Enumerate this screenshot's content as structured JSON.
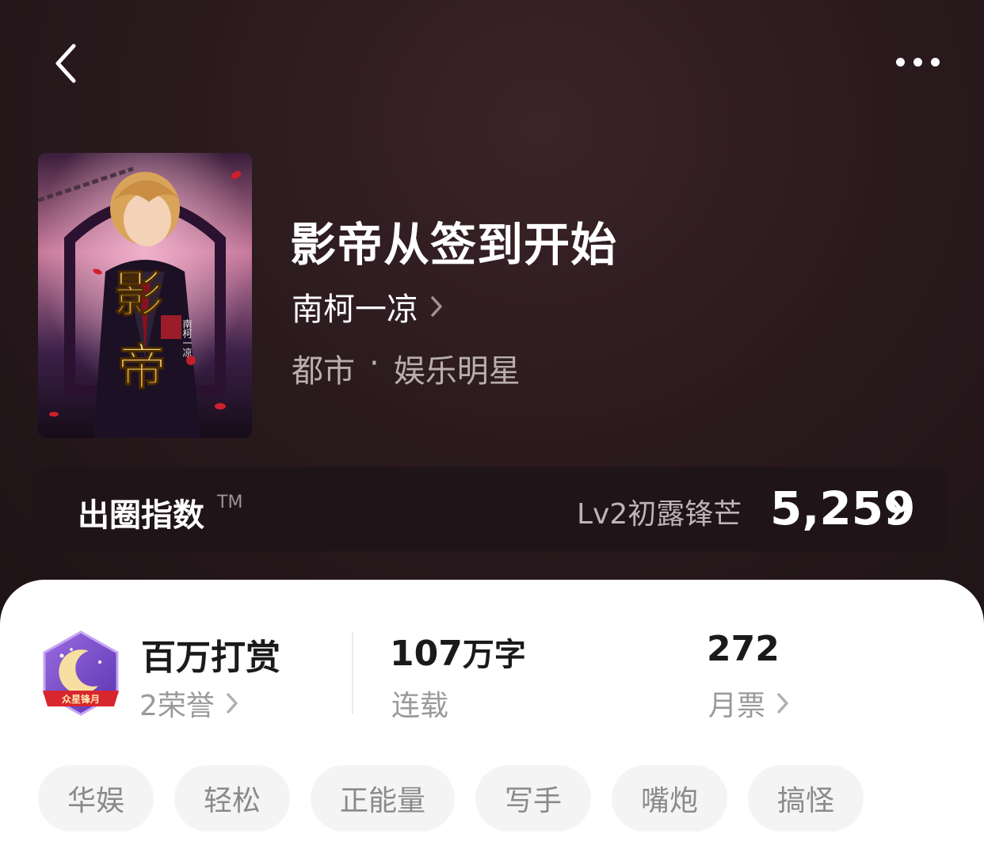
{
  "header": {
    "back_icon": "chevron-left-icon",
    "more_icon": "more-dots-icon"
  },
  "book": {
    "title": "影帝从签到开始",
    "author": "南柯一凉",
    "category": "都市",
    "separator": "·",
    "subcategory": "娱乐明星",
    "cover": {
      "big_chars": [
        "影",
        "帝"
      ],
      "author_vertical": "南柯一凉"
    }
  },
  "index": {
    "title": "出圈指数",
    "tm": "TM",
    "level": "Lv2初露锋芒",
    "score": "5,259"
  },
  "stats": {
    "honor": {
      "title": "百万打赏",
      "sub": "2荣誉",
      "badge_text": "众星锋月"
    },
    "words": {
      "value": "107",
      "unit": "万字",
      "sub": "连载"
    },
    "tickets": {
      "value": "272",
      "sub": "月票"
    }
  },
  "tags": [
    "华娱",
    "轻松",
    "正能量",
    "写手",
    "嘴炮",
    "搞怪"
  ],
  "colors": {
    "hero_bg": "#2a1a1e",
    "index_bg": "#1f1417",
    "tag_bg": "#f4f4f4",
    "badge_purple": "#7a4fc9",
    "ribbon_red": "#d8262e"
  }
}
